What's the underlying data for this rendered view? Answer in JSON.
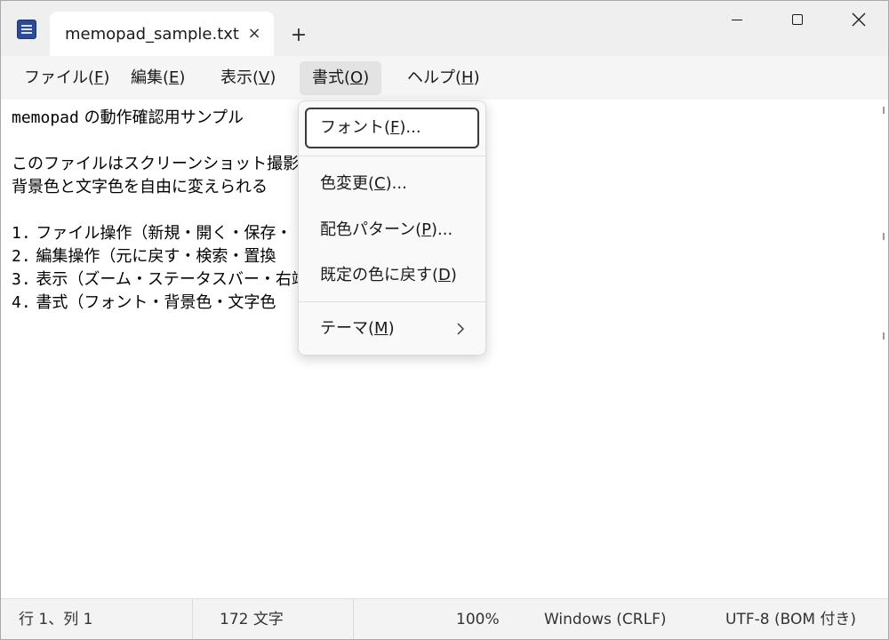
{
  "window": {
    "tab_title": "memopad_sample.txt",
    "new_tab_glyph": "+",
    "close_tab_glyph": "×"
  },
  "menu": {
    "file": {
      "label": "ファイル(",
      "acc": "F",
      "end": ")"
    },
    "edit": {
      "label": "編集(",
      "acc": "E",
      "end": ")"
    },
    "view": {
      "label": "表示(",
      "acc": "V",
      "end": ")"
    },
    "format": {
      "label": "書式(",
      "acc": "O",
      "end": ")"
    },
    "help": {
      "label": "ヘルプ(",
      "acc": "H",
      "end": ")"
    }
  },
  "format_menu": {
    "font": {
      "label": "フォント(",
      "acc": "F",
      "end": ")..."
    },
    "color": {
      "label": "色変更(",
      "acc": "C",
      "end": ")..."
    },
    "pattern": {
      "label": "配色パターン(",
      "acc": "P",
      "end": ")..."
    },
    "default": {
      "label": "既定の色に戻す(",
      "acc": "D",
      "end": ")"
    },
    "theme": {
      "label": "テーマ(",
      "acc": "M",
      "end": ")"
    },
    "chevron_icon": "chevron-right-icon"
  },
  "editor": {
    "line1_mono": "memopad",
    "line1_rest": " の動作確認用サンプル",
    "line3": "このファイルはスクリーンショット撮影用",
    "line4": "背景色と文字色を自由に変えられる",
    "line6_num": "1.",
    "line6": "ファイル操作（新規・開く・保存・",
    "line7_num": "2.",
    "line7": "編集操作（元に戻す・検索・置換",
    "line8_num": "3.",
    "line8": "表示（ズーム・ステータスバー・右端",
    "line9_num": "4.",
    "line9": "書式（フォント・背景色・文字色"
  },
  "status": {
    "position": "行 1、列 1",
    "chars": "172 文字",
    "zoom": "100%",
    "line_ending": "Windows (CRLF)",
    "encoding": "UTF-8 (BOM 付き)"
  },
  "colors": {
    "accent_border": "#3a3a3a",
    "app_icon": "#2b4c94"
  }
}
